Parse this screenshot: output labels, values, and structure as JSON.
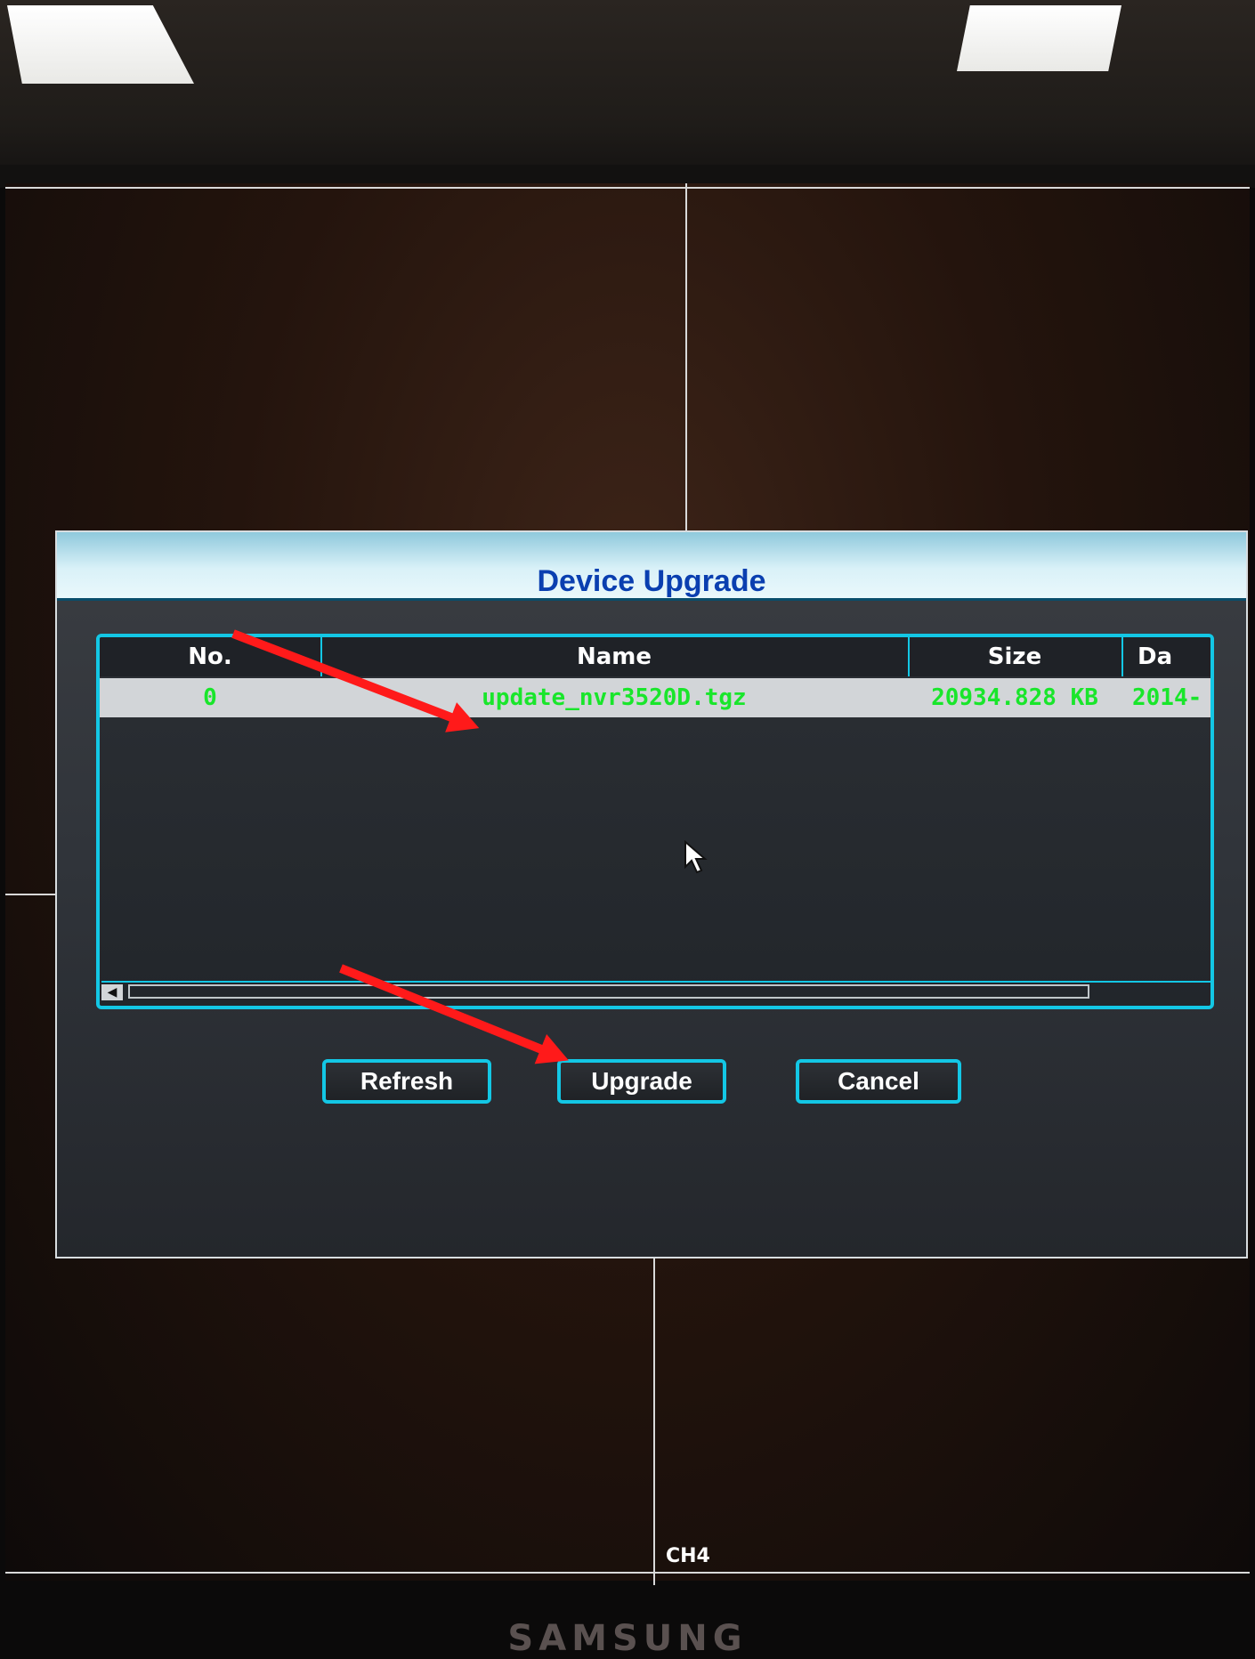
{
  "dialog": {
    "title": "Device Upgrade",
    "table": {
      "columns": [
        "No.",
        "Name",
        "Size",
        "Da"
      ],
      "rows": [
        {
          "no": "0",
          "name": "update_nvr3520D.tgz",
          "size": "20934.828 KB",
          "date": "2014-"
        }
      ]
    },
    "buttons": {
      "refresh": "Refresh",
      "upgrade": "Upgrade",
      "cancel": "Cancel"
    }
  },
  "screen": {
    "channel_label": "CH4"
  },
  "monitor": {
    "brand": "SAMSUNG"
  },
  "colors": {
    "accent": "#13c7e5",
    "row_text": "#19e62b",
    "title": "#0a3fb0",
    "arrow": "#ff1a1a"
  }
}
